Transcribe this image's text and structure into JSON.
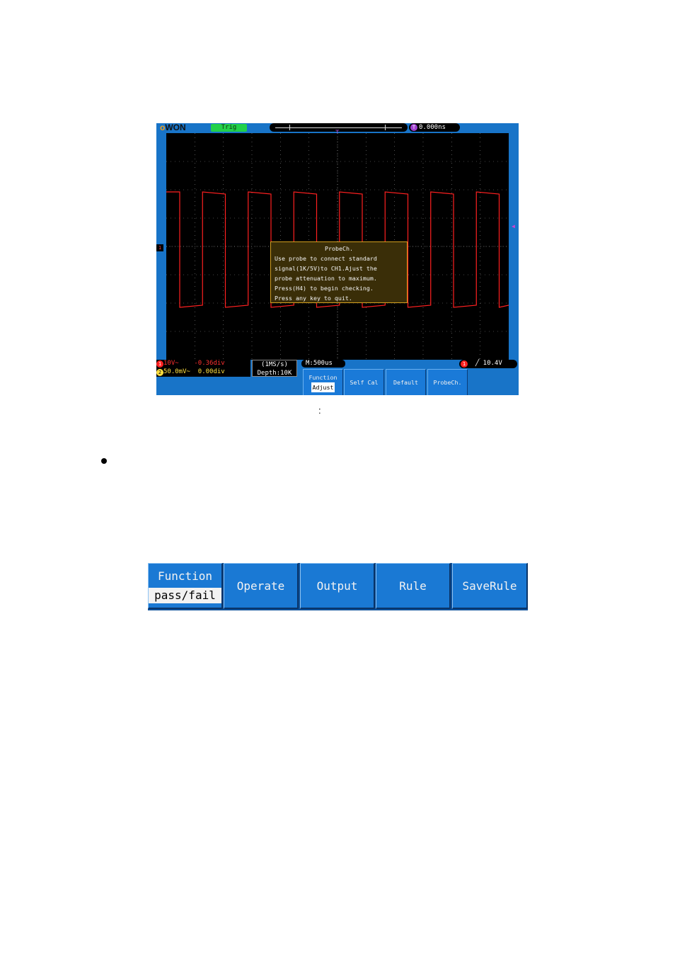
{
  "scope": {
    "logo_o": "o",
    "logo_rest": "WON",
    "trig_status": "Trig",
    "time_position": "0.000ns",
    "time_position_icon": "T",
    "trigger_marker_icon": "T",
    "ch1_marker": "1",
    "trigger_level_marker": "◀",
    "dialog": {
      "title": "ProbeCh.",
      "lines": [
        "Use probe to connect standard",
        "signal(1K/5V)to CH1.Ajust the",
        "probe attenuation to maximum.",
        "Press(H4) to begin checking.",
        "Press any key to quit."
      ]
    },
    "status": {
      "ch1_num": "1",
      "ch1_volt": "10V~",
      "ch1_offset": "-0.36div",
      "ch2_num": "2",
      "ch2_volt": "50.0mV~",
      "ch2_offset": "0.00div",
      "sample_rate": "(1MS/s)",
      "depth": "Depth:10K",
      "timebase": "M:500us",
      "trig_num": "1",
      "trig_level": "╱ 10.4V"
    },
    "softkeys": {
      "function_label": "Function",
      "function_value": "Adjust",
      "self_cal": "Self Cal",
      "default": "Default",
      "probe_ch": "ProbeCh."
    },
    "colors": {
      "ch1_trace": "#ff2020",
      "ch2": "#ffe040",
      "screen_bg": "#1874c8"
    }
  },
  "caption_colon": ":",
  "menu": {
    "function_label": "Function",
    "function_value": "pass/fail",
    "operate": "Operate",
    "output": "Output",
    "rule": "Rule",
    "save_rule": "SaveRule"
  }
}
